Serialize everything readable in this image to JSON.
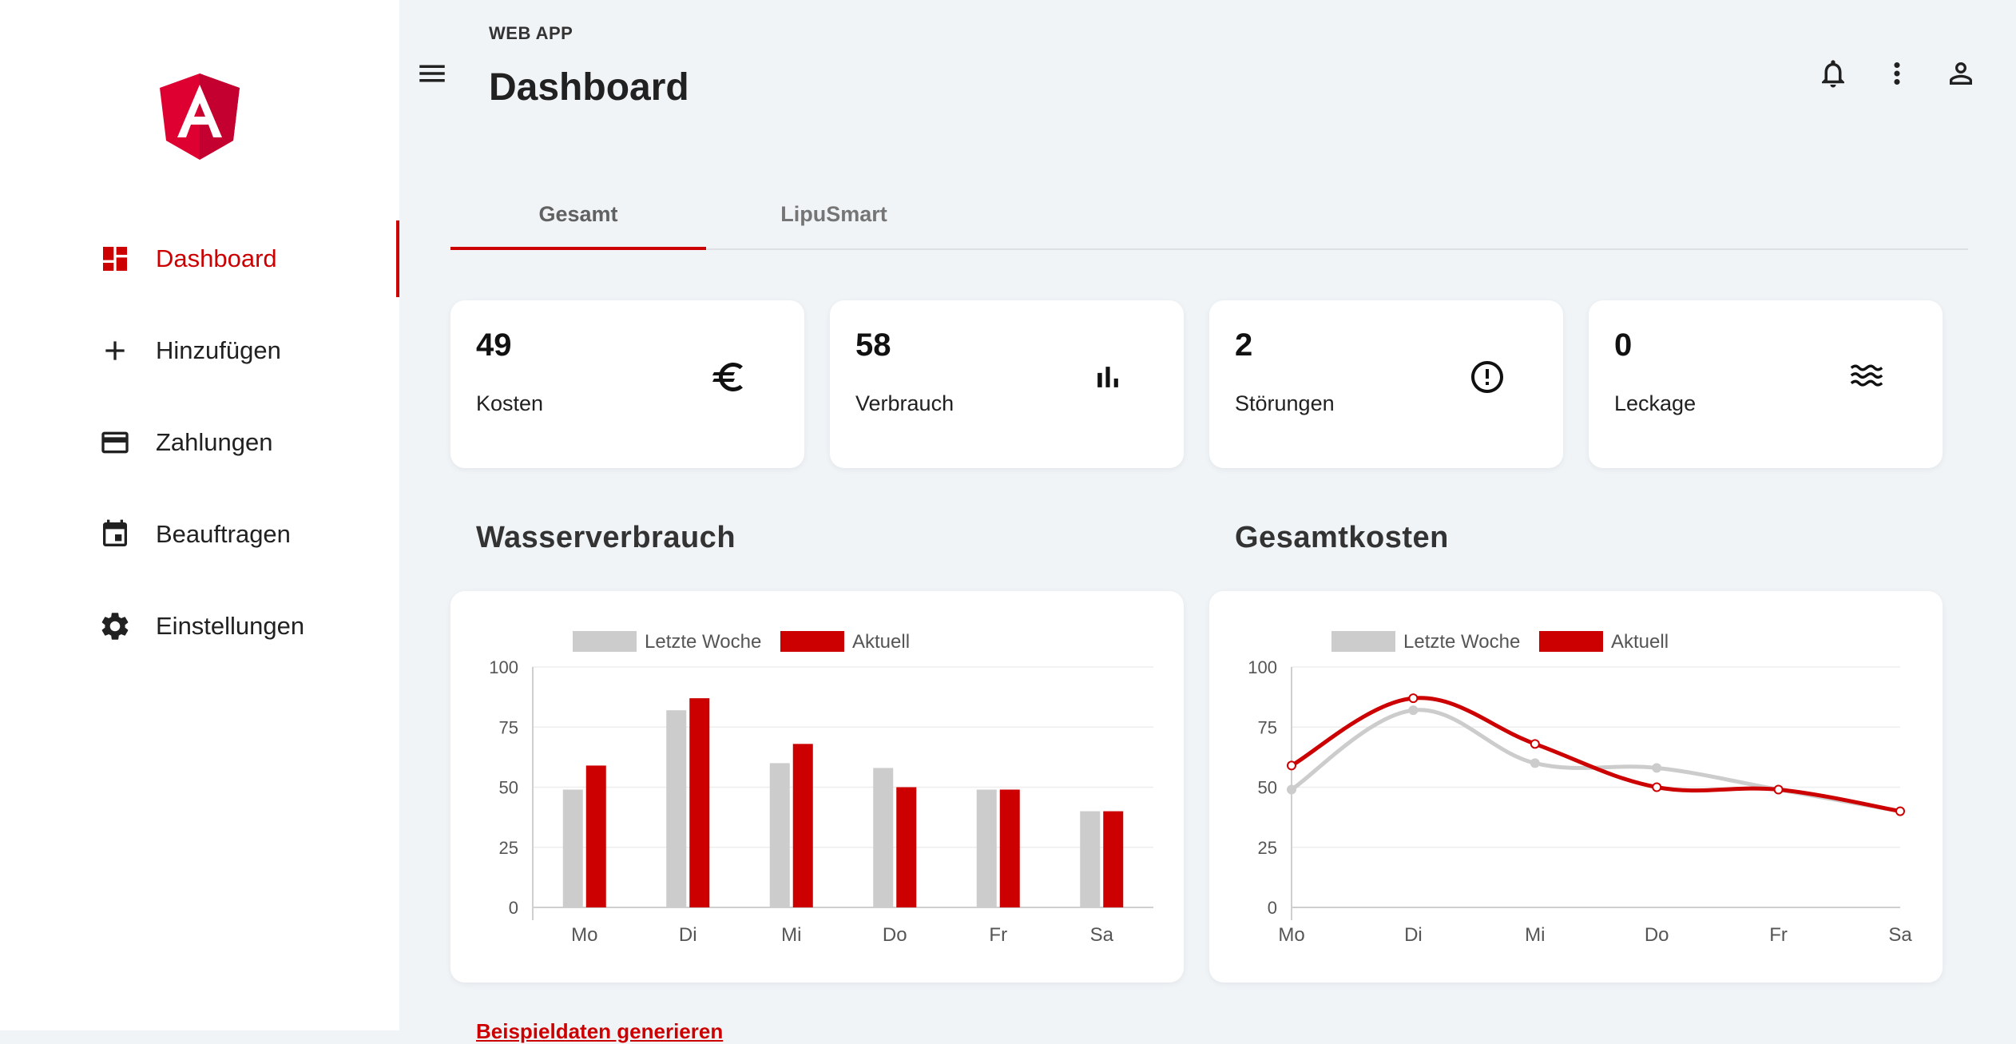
{
  "app": {
    "label": "WEB APP",
    "page_title": "Dashboard"
  },
  "colors": {
    "accent": "#cc0000",
    "last_week": "#cccccc",
    "background": "#f0f4f7"
  },
  "sidebar": {
    "logo": "angular-logo",
    "items": [
      {
        "label": "Dashboard",
        "icon": "dashboard-icon",
        "active": true
      },
      {
        "label": "Hinzufügen",
        "icon": "plus-icon",
        "active": false
      },
      {
        "label": "Zahlungen",
        "icon": "credit-card-icon",
        "active": false
      },
      {
        "label": "Beauftragen",
        "icon": "calendar-icon",
        "active": false
      },
      {
        "label": "Einstellungen",
        "icon": "gear-icon",
        "active": false
      }
    ]
  },
  "header": {
    "icons": [
      "bell-icon",
      "more-vert-icon",
      "account-icon"
    ]
  },
  "tabs": [
    {
      "label": "Gesamt",
      "active": true
    },
    {
      "label": "LipuSmart",
      "active": false
    }
  ],
  "stats": [
    {
      "value": "49",
      "label": "Kosten",
      "icon": "euro-icon"
    },
    {
      "value": "58",
      "label": "Verbrauch",
      "icon": "bar-chart-icon"
    },
    {
      "value": "2",
      "label": "Störungen",
      "icon": "alert-circle-icon"
    },
    {
      "value": "0",
      "label": "Leckage",
      "icon": "waves-icon"
    }
  ],
  "sections": {
    "water": "Wasserverbrauch",
    "costs": "Gesamtkosten"
  },
  "footer": {
    "link": "Beispieldaten generieren"
  },
  "chart_data": [
    {
      "type": "bar",
      "categories": [
        "Mo",
        "Di",
        "Mi",
        "Do",
        "Fr",
        "Sa"
      ],
      "series": [
        {
          "name": "Letzte Woche",
          "values": [
            49,
            82,
            60,
            58,
            49,
            40
          ]
        },
        {
          "name": "Aktuell",
          "values": [
            59,
            87,
            68,
            50,
            49,
            40
          ]
        }
      ],
      "yticks": [
        "0",
        "25",
        "50",
        "75",
        "100"
      ],
      "ylim": [
        0,
        100
      ],
      "legend": "top"
    },
    {
      "type": "line",
      "categories": [
        "Mo",
        "Di",
        "Mi",
        "Do",
        "Fr",
        "Sa"
      ],
      "series": [
        {
          "name": "Letzte Woche",
          "values": [
            49,
            82,
            60,
            58,
            49,
            40
          ]
        },
        {
          "name": "Aktuell",
          "values": [
            59,
            87,
            68,
            50,
            49,
            40
          ]
        }
      ],
      "yticks": [
        "0",
        "25",
        "50",
        "75",
        "100"
      ],
      "ylim": [
        0,
        100
      ],
      "legend": "top"
    }
  ]
}
